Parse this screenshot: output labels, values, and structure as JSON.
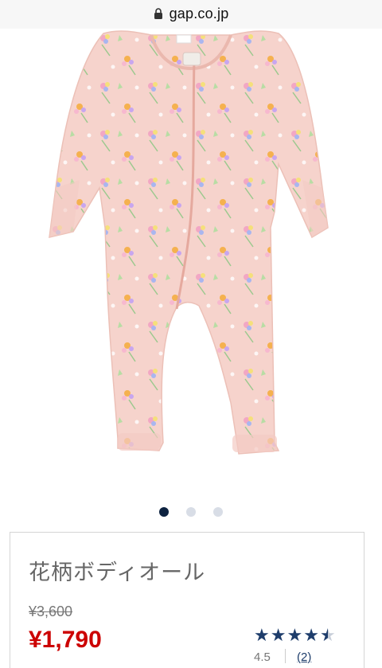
{
  "browser": {
    "url": "gap.co.jp"
  },
  "carousel": {
    "active_index": 0,
    "total": 3
  },
  "product": {
    "name": "花柄ボディオール",
    "original_price": "¥3,600",
    "sale_price": "¥1,790",
    "rating": "4.5",
    "stars": 4.5,
    "reviews": "(2)"
  },
  "colors": {
    "sale_red": "#cc0000",
    "navy": "#1e3d6b",
    "romper_pink": "#f7d4cd"
  }
}
